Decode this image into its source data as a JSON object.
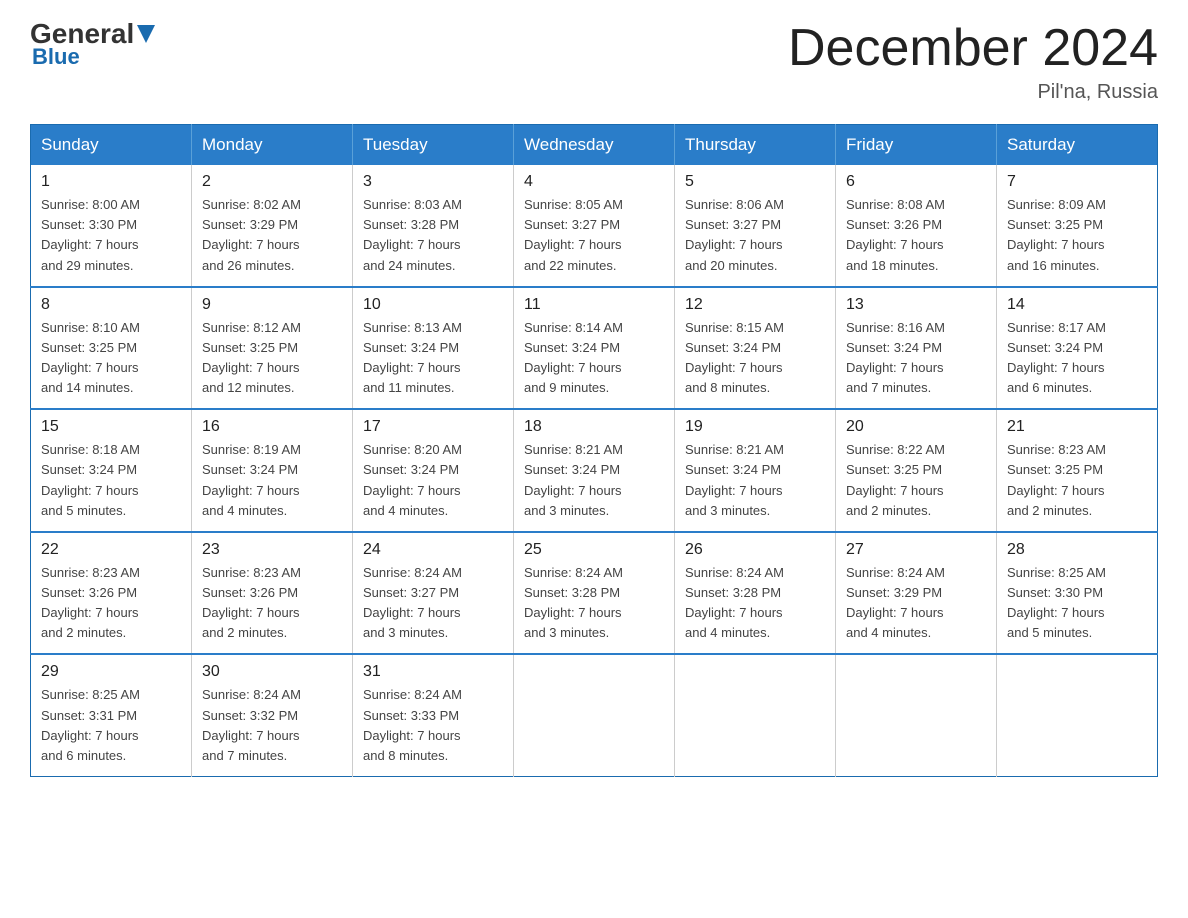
{
  "header": {
    "logo_general": "General",
    "logo_blue": "Blue",
    "month_title": "December 2024",
    "location": "Pil'na, Russia"
  },
  "days_of_week": [
    "Sunday",
    "Monday",
    "Tuesday",
    "Wednesday",
    "Thursday",
    "Friday",
    "Saturday"
  ],
  "weeks": [
    [
      {
        "day": "1",
        "sunrise": "8:00 AM",
        "sunset": "3:30 PM",
        "daylight": "7 hours and 29 minutes."
      },
      {
        "day": "2",
        "sunrise": "8:02 AM",
        "sunset": "3:29 PM",
        "daylight": "7 hours and 26 minutes."
      },
      {
        "day": "3",
        "sunrise": "8:03 AM",
        "sunset": "3:28 PM",
        "daylight": "7 hours and 24 minutes."
      },
      {
        "day": "4",
        "sunrise": "8:05 AM",
        "sunset": "3:27 PM",
        "daylight": "7 hours and 22 minutes."
      },
      {
        "day": "5",
        "sunrise": "8:06 AM",
        "sunset": "3:27 PM",
        "daylight": "7 hours and 20 minutes."
      },
      {
        "day": "6",
        "sunrise": "8:08 AM",
        "sunset": "3:26 PM",
        "daylight": "7 hours and 18 minutes."
      },
      {
        "day": "7",
        "sunrise": "8:09 AM",
        "sunset": "3:25 PM",
        "daylight": "7 hours and 16 minutes."
      }
    ],
    [
      {
        "day": "8",
        "sunrise": "8:10 AM",
        "sunset": "3:25 PM",
        "daylight": "7 hours and 14 minutes."
      },
      {
        "day": "9",
        "sunrise": "8:12 AM",
        "sunset": "3:25 PM",
        "daylight": "7 hours and 12 minutes."
      },
      {
        "day": "10",
        "sunrise": "8:13 AM",
        "sunset": "3:24 PM",
        "daylight": "7 hours and 11 minutes."
      },
      {
        "day": "11",
        "sunrise": "8:14 AM",
        "sunset": "3:24 PM",
        "daylight": "7 hours and 9 minutes."
      },
      {
        "day": "12",
        "sunrise": "8:15 AM",
        "sunset": "3:24 PM",
        "daylight": "7 hours and 8 minutes."
      },
      {
        "day": "13",
        "sunrise": "8:16 AM",
        "sunset": "3:24 PM",
        "daylight": "7 hours and 7 minutes."
      },
      {
        "day": "14",
        "sunrise": "8:17 AM",
        "sunset": "3:24 PM",
        "daylight": "7 hours and 6 minutes."
      }
    ],
    [
      {
        "day": "15",
        "sunrise": "8:18 AM",
        "sunset": "3:24 PM",
        "daylight": "7 hours and 5 minutes."
      },
      {
        "day": "16",
        "sunrise": "8:19 AM",
        "sunset": "3:24 PM",
        "daylight": "7 hours and 4 minutes."
      },
      {
        "day": "17",
        "sunrise": "8:20 AM",
        "sunset": "3:24 PM",
        "daylight": "7 hours and 4 minutes."
      },
      {
        "day": "18",
        "sunrise": "8:21 AM",
        "sunset": "3:24 PM",
        "daylight": "7 hours and 3 minutes."
      },
      {
        "day": "19",
        "sunrise": "8:21 AM",
        "sunset": "3:24 PM",
        "daylight": "7 hours and 3 minutes."
      },
      {
        "day": "20",
        "sunrise": "8:22 AM",
        "sunset": "3:25 PM",
        "daylight": "7 hours and 2 minutes."
      },
      {
        "day": "21",
        "sunrise": "8:23 AM",
        "sunset": "3:25 PM",
        "daylight": "7 hours and 2 minutes."
      }
    ],
    [
      {
        "day": "22",
        "sunrise": "8:23 AM",
        "sunset": "3:26 PM",
        "daylight": "7 hours and 2 minutes."
      },
      {
        "day": "23",
        "sunrise": "8:23 AM",
        "sunset": "3:26 PM",
        "daylight": "7 hours and 2 minutes."
      },
      {
        "day": "24",
        "sunrise": "8:24 AM",
        "sunset": "3:27 PM",
        "daylight": "7 hours and 3 minutes."
      },
      {
        "day": "25",
        "sunrise": "8:24 AM",
        "sunset": "3:28 PM",
        "daylight": "7 hours and 3 minutes."
      },
      {
        "day": "26",
        "sunrise": "8:24 AM",
        "sunset": "3:28 PM",
        "daylight": "7 hours and 4 minutes."
      },
      {
        "day": "27",
        "sunrise": "8:24 AM",
        "sunset": "3:29 PM",
        "daylight": "7 hours and 4 minutes."
      },
      {
        "day": "28",
        "sunrise": "8:25 AM",
        "sunset": "3:30 PM",
        "daylight": "7 hours and 5 minutes."
      }
    ],
    [
      {
        "day": "29",
        "sunrise": "8:25 AM",
        "sunset": "3:31 PM",
        "daylight": "7 hours and 6 minutes."
      },
      {
        "day": "30",
        "sunrise": "8:24 AM",
        "sunset": "3:32 PM",
        "daylight": "7 hours and 7 minutes."
      },
      {
        "day": "31",
        "sunrise": "8:24 AM",
        "sunset": "3:33 PM",
        "daylight": "7 hours and 8 minutes."
      },
      null,
      null,
      null,
      null
    ]
  ]
}
